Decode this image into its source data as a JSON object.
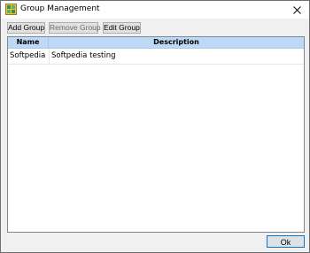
{
  "window": {
    "title": "Group Management",
    "app_icon": "group-management-app-icon",
    "close_icon": "close-icon"
  },
  "toolbar": {
    "add_label": "Add Group",
    "remove_label": "Remove Group",
    "edit_label": "Edit Group"
  },
  "grid": {
    "columns": [
      "Name",
      "Description"
    ],
    "rows": [
      {
        "name": "Softpedia",
        "description": "Softpedia testing"
      }
    ]
  },
  "footer": {
    "ok_label": "Ok"
  },
  "colors": {
    "header_background": "#bdd9f5",
    "focus_border": "#0078d7",
    "window_background": "#f0f0f0"
  }
}
